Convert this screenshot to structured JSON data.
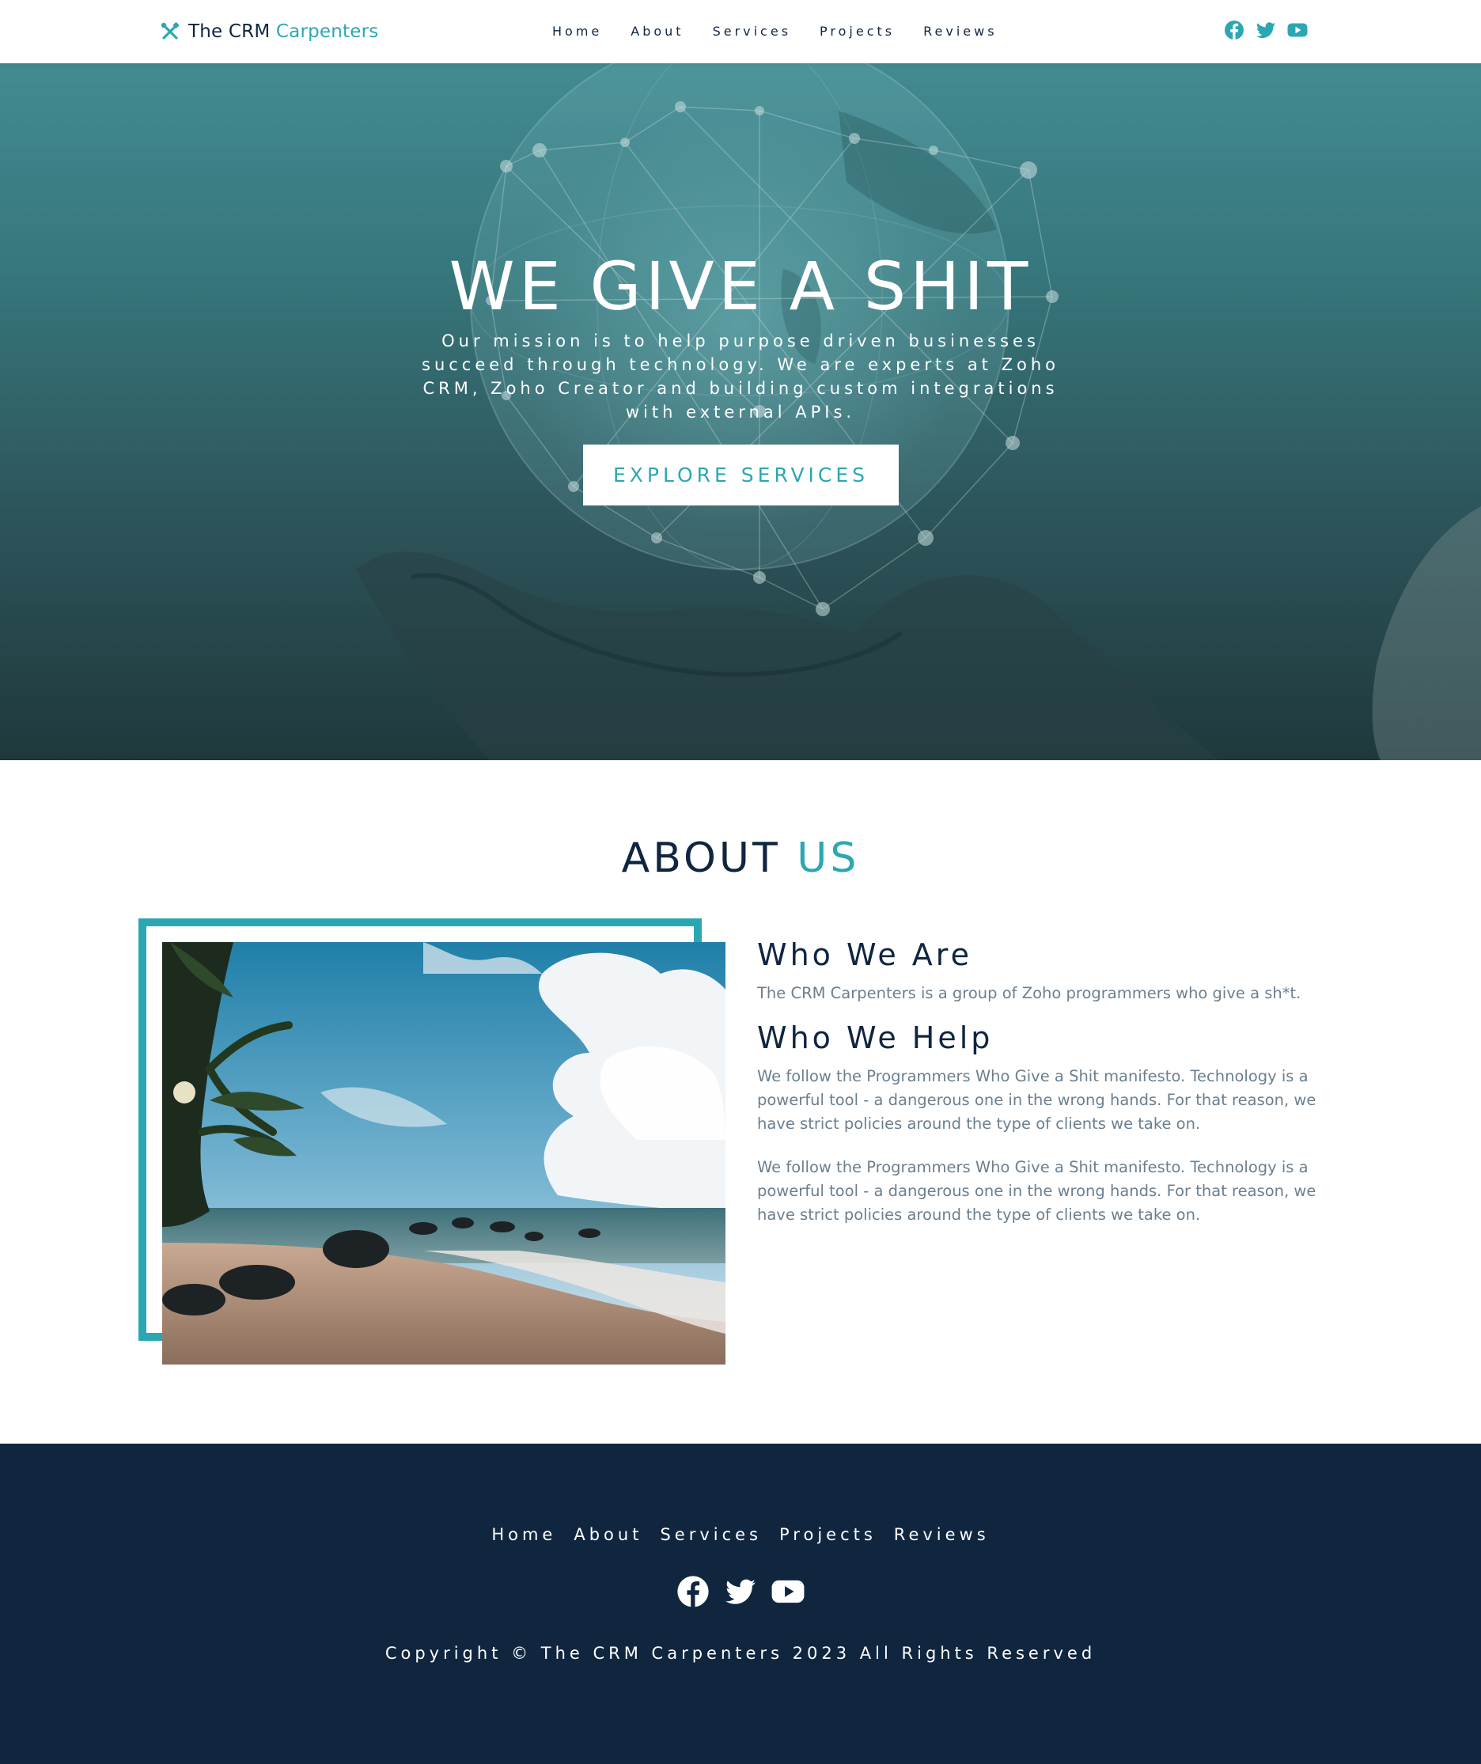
{
  "colors": {
    "accent": "#2ba7b4",
    "navy": "#10263f",
    "text_muted": "#6b7f8f",
    "white": "#ffffff"
  },
  "nav": {
    "brand": {
      "icon": "tools-icon",
      "name_part1": "The CRM",
      "name_part2": "Carpenters"
    },
    "links": [
      {
        "label": "Home"
      },
      {
        "label": "About"
      },
      {
        "label": "Services"
      },
      {
        "label": "Projects"
      },
      {
        "label": "Reviews"
      }
    ],
    "social": [
      "facebook-icon",
      "twitter-icon",
      "youtube-icon"
    ]
  },
  "hero": {
    "title": "WE GIVE A SHIT",
    "subtitle": "Our mission is to help purpose driven businesses succeed through technology. We are experts at Zoho CRM, Zoho Creator and building custom integrations with external APIs.",
    "button_label": "EXPLORE SERVICES"
  },
  "about": {
    "title_part1": "ABOUT",
    "title_part2": "US",
    "who_we_are_title": "Who We Are",
    "who_we_are_text": "The CRM Carpenters is a group of Zoho programmers who give a sh*t.",
    "who_we_help_title": "Who We Help",
    "who_we_help_text_1": "We follow the Programmers Who Give a Shit manifesto. Technology is a powerful tool - a dangerous one in the wrong hands. For that reason, we have strict policies around the type of clients we take on.",
    "who_we_help_text_2": "We follow the Programmers Who Give a Shit manifesto. Technology is a powerful tool - a dangerous one in the wrong hands. For that reason, we have strict policies around the type of clients we take on."
  },
  "footer": {
    "links": [
      {
        "label": "Home"
      },
      {
        "label": "About"
      },
      {
        "label": "Services"
      },
      {
        "label": "Projects"
      },
      {
        "label": "Reviews"
      }
    ],
    "social": [
      "facebook-icon",
      "twitter-icon",
      "youtube-icon"
    ],
    "copyright": "Copyright © The CRM Carpenters 2023 All Rights Reserved"
  }
}
